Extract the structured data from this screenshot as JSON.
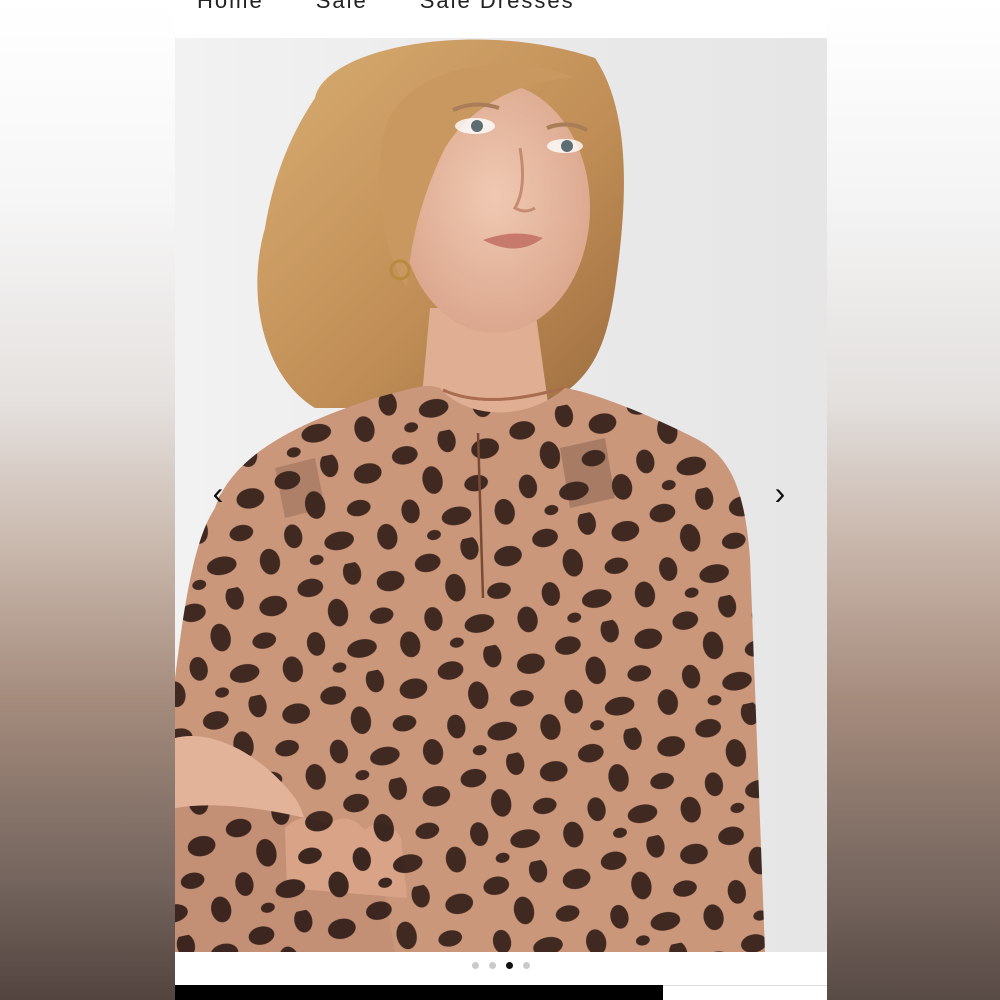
{
  "breadcrumb": {
    "items": [
      "Home",
      "Sale",
      "Sale Dresses"
    ]
  },
  "gallery": {
    "prev_icon": "chevron-left-icon",
    "next_icon": "chevron-right-icon",
    "prev_glyph": "‹",
    "next_glyph": "›",
    "slide_count": 4,
    "active_slide": 3
  },
  "colors": {
    "print_base": "#d9a387",
    "print_spot": "#3b2620",
    "skin": "#e7bba2",
    "hair": "#c9995f",
    "accent": "#000000"
  }
}
